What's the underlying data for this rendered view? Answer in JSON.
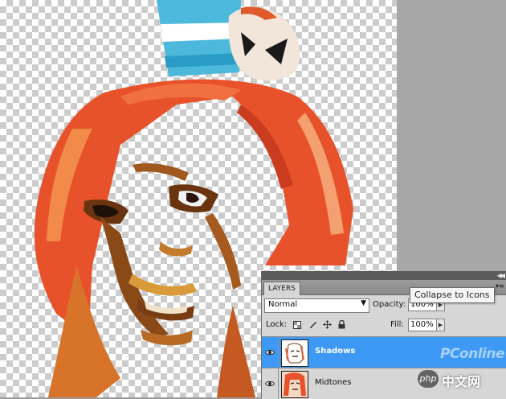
{
  "layers_panel": {
    "tab_label": "LAYERS",
    "blend_mode": "Normal",
    "opacity_label": "Opacity:",
    "opacity_value": "100%",
    "lock_label": "Lock:",
    "fill_label": "Fill:",
    "fill_value": "100%",
    "layers": [
      {
        "name": "Shadows",
        "selected": true,
        "visible": true
      },
      {
        "name": "Midtones",
        "selected": false,
        "visible": true
      }
    ]
  },
  "tooltip": {
    "text": "Collapse to Icons"
  },
  "watermark": {
    "brand": "PConline",
    "badge": "php",
    "text": "中文网"
  },
  "icons": {
    "visibility": "eye-icon",
    "dropdown": "chevron-down-icon",
    "spin": "triangle-right-icon",
    "lock_pixels": "checker-icon",
    "lock_image": "brush-icon",
    "lock_position": "move-icon",
    "lock_all": "padlock-icon",
    "collapse": "double-chevron-icon"
  },
  "colors": {
    "selected_layer": "#3d99f3",
    "hair": "#e8522a",
    "hat": "#4cb8dc"
  }
}
